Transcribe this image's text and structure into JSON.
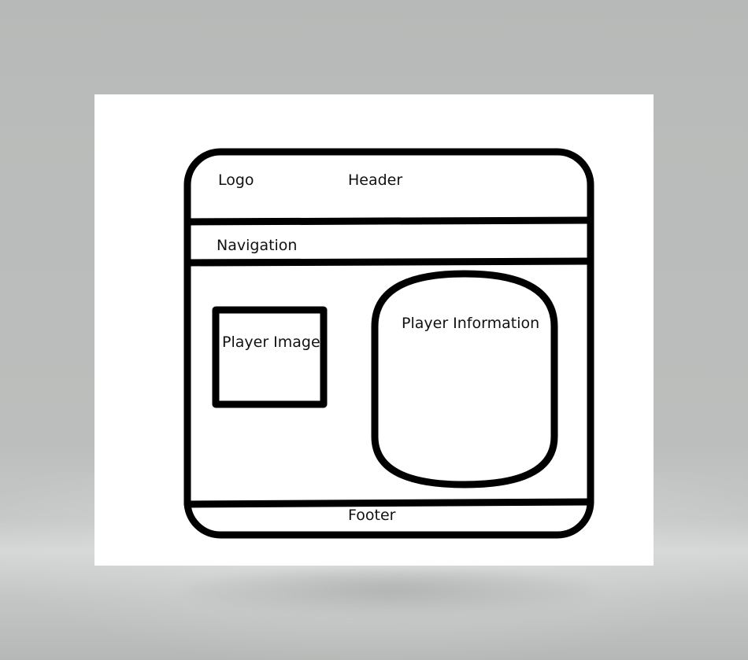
{
  "diagram": {
    "labels": {
      "logo": "Logo",
      "header": "Header",
      "navigation": "Navigation",
      "player_image": "Player Image",
      "player_information": "Player Information",
      "footer": "Footer"
    },
    "colors": {
      "stroke": "#000000",
      "paper": "#ffffff",
      "backdrop": "#b9bbba"
    }
  }
}
